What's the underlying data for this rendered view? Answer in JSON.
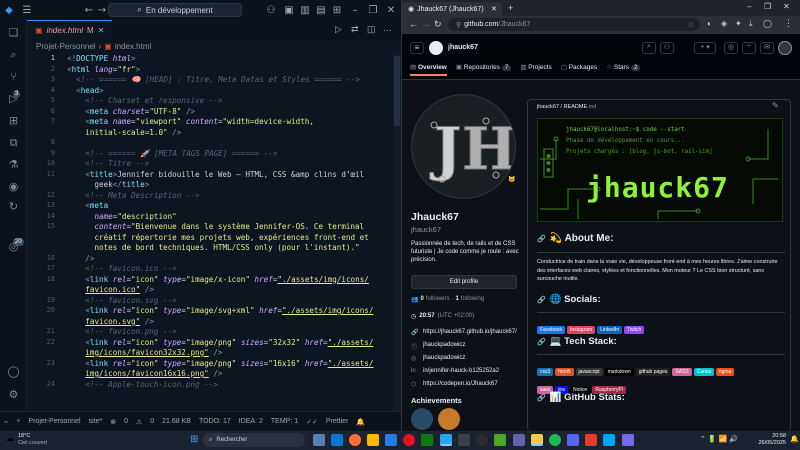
{
  "vscode": {
    "title": "En développement",
    "tab": {
      "name": "index.html",
      "status": "M"
    },
    "breadcrumb": [
      "Projet-Personnel",
      "index.html"
    ],
    "activity_badges": [
      "3",
      "20"
    ],
    "lines": [
      {
        "n": "1",
        "html": "<span class='p'>&lt;!</span><span class='t'>DOCTYPE</span> <span class='a'>html</span><span class='p'>&gt;</span>"
      },
      {
        "n": "2",
        "html": "<span class='p'>&lt;</span><span class='t'>html</span> <span class='a'>lang</span>=<span class='s'>\"fr\"</span><span class='p'>&gt;</span>"
      },
      {
        "n": "3",
        "html": "  <span class='c'>&lt;!-- ====== 🧠 [HEAD] : Titre, Meta Datas et Styles ====== --&gt;</span>"
      },
      {
        "n": "4",
        "html": "  <span class='p'>&lt;</span><span class='t'>head</span><span class='p'>&gt;</span>"
      },
      {
        "n": "5",
        "html": "    <span class='c'>&lt;!-- Charset et responsive --&gt;</span>"
      },
      {
        "n": "6",
        "html": "    <span class='p'>&lt;</span><span class='t'>meta</span> <span class='a'>charset</span>=<span class='s'>\"UTF-8\"</span> <span class='p'>/&gt;</span>"
      },
      {
        "n": "7",
        "html": "    <span class='p'>&lt;</span><span class='t'>meta</span> <span class='a'>name</span>=<span class='s'>\"viewport\"</span> <span class='a'>content</span>=<span class='s'>\"width=device-width,</span>"
      },
      {
        "n": "",
        "html": "    <span class='s'>initial-scale=1.0\"</span> <span class='p'>/&gt;</span>"
      },
      {
        "n": "8",
        "html": ""
      },
      {
        "n": "9",
        "html": "    <span class='c'>&lt;!-- ====== 🚀 [META TAGS PAGE] ====== --&gt;</span>"
      },
      {
        "n": "10",
        "html": "    <span class='c'>&lt;!-- Titre --&gt;</span>"
      },
      {
        "n": "11",
        "html": "    <span class='p'>&lt;</span><span class='t'>title</span><span class='p'>&gt;</span>Jennifer bidouille le Web – HTML, CSS &amp;amp clins d’œil"
      },
      {
        "n": "",
        "html": "      geek<span class='p'>&lt;/</span><span class='t'>title</span><span class='p'>&gt;</span>"
      },
      {
        "n": "12",
        "html": "    <span class='c'>&lt;!-- Meta Description --&gt;</span>"
      },
      {
        "n": "13",
        "html": "    <span class='p'>&lt;</span><span class='t'>meta</span>"
      },
      {
        "n": "14",
        "html": "      <span class='a'>name</span>=<span class='s'>\"description\"</span>"
      },
      {
        "n": "15",
        "html": "      <span class='a'>content</span>=<span class='s'>\"Bienvenue dans le système Jennifer-OS. Ce terminal</span>"
      },
      {
        "n": "",
        "html": "      <span class='s'>créatif répertorie mes projets web, expériences front-end et</span>"
      },
      {
        "n": "",
        "html": "      <span class='s'>notes de bord techniques. HTML/CSS only (pour l'instant).\"</span>"
      },
      {
        "n": "16",
        "html": "    <span class='p'>/&gt;</span>"
      },
      {
        "n": "17",
        "html": "    <span class='c'>&lt;!-- favicon.ico --&gt;</span>"
      },
      {
        "n": "18",
        "html": "    <span class='p'>&lt;</span><span class='t'>link</span> <span class='a'>rel</span>=<span class='s'>\"icon\"</span> <span class='a'>type</span>=<span class='s'>\"image/x-icon\"</span> <span class='a'>href</span>=<span class='s'><u>\"./assets/img/icons/</u></span>"
      },
      {
        "n": "",
        "html": "    <span class='s'><u>favicon.ico\"</u></span> <span class='p'>/&gt;</span>"
      },
      {
        "n": "19",
        "html": "    <span class='c'>&lt;!-- favicon.svg --&gt;</span>"
      },
      {
        "n": "20",
        "html": "    <span class='p'>&lt;</span><span class='t'>link</span> <span class='a'>rel</span>=<span class='s'>\"icon\"</span> <span class='a'>type</span>=<span class='s'>\"image/svg+xml\"</span> <span class='a'>href</span>=<span class='s'><u>\"./assets/img/icons/</u></span>"
      },
      {
        "n": "",
        "html": "    <span class='s'><u>favicon.svg\"</u></span> <span class='p'>/&gt;</span>"
      },
      {
        "n": "21",
        "html": "    <span class='c'>&lt;!-- favicon.png --&gt;</span>"
      },
      {
        "n": "22",
        "html": "    <span class='p'>&lt;</span><span class='t'>link</span> <span class='a'>rel</span>=<span class='s'>\"icon\"</span> <span class='a'>type</span>=<span class='s'>\"image/png\"</span> <span class='a'>sizes</span>=<span class='s'>\"32x32\"</span> <span class='a'>href</span>=<span class='s'><u>\"./assets/</u></span>"
      },
      {
        "n": "",
        "html": "    <span class='s'><u>img/icons/favicon32x32.png\"</u></span> <span class='p'>/&gt;</span>"
      },
      {
        "n": "23",
        "html": "    <span class='p'>&lt;</span><span class='t'>link</span> <span class='a'>rel</span>=<span class='s'>\"icon\"</span> <span class='a'>type</span>=<span class='s'>\"image/png\"</span> <span class='a'>sizes</span>=<span class='s'>\"16x16\"</span> <span class='a'>href</span>=<span class='s'><u>\"./assets/</u></span>"
      },
      {
        "n": "",
        "html": "    <span class='s'><u>img/icons/favicon16x16.png\"</u></span> <span class='p'>/&gt;</span>"
      },
      {
        "n": "24",
        "html": "    <span class='c'>&lt;!-- Apple-touch-icon.png --&gt;</span>"
      }
    ],
    "status": {
      "branch": "Projet-Personnel",
      "site": "site*",
      "errors": "0",
      "warnings": "0",
      "size": "21.68 KB",
      "todo": "TODO: 17",
      "idea": "IDEA: 2",
      "temp": "TEMP: 1",
      "prettier": "Prettier"
    }
  },
  "browser": {
    "tab_title": "Jhauck67 (Jhauck67)",
    "url_host": "github.com",
    "url_path": "/Jhauck67",
    "gh_user": "jhauck67",
    "nav": [
      {
        "label": "Overview",
        "count": ""
      },
      {
        "label": "Repositories",
        "count": "7"
      },
      {
        "label": "Projects",
        "count": ""
      },
      {
        "label": "Packages",
        "count": ""
      },
      {
        "label": "Stars",
        "count": "2"
      }
    ],
    "profile": {
      "name": "Jhauck67",
      "login": "jhauck67",
      "bio": "Passionnée de tech, de rails et de CSS futuriste | Je code comme je roule : avec précision.",
      "edit_button": "Edit profile",
      "followers": "0",
      "followers_label": "followers",
      "following": "1",
      "following_label": "following",
      "time": "20:57",
      "tz": "(UTC +02:00)",
      "links": [
        "https://jhauck67.github.io/jhauck67/",
        "jhauckpadowicz",
        "jhauckpadowicz",
        "in/jennifer-hauck-b125252a2",
        "https://codepen.io/Jhauck67"
      ],
      "achievements": "Achievements"
    },
    "readme": {
      "path": "jhauck67 / README",
      "ext": ".md",
      "terminal": [
        "jhauck67@localhost:~$ code --start",
        "Phase de développement en cours...",
        "Projets chargés : [blog, js-bot, rail-sim]"
      ],
      "banner": "jhauck67",
      "about_title": "💫 About Me:",
      "about_text": "Conductrice de train dans la vraie vie, développeuse front-end à mes heures libres. J'aime construire des interfaces web claires, stylées et fonctionnelles. Mon moteur ? Le CSS bien structuré, sans surcouche inutile.",
      "socials_title": "🌐 Socials:",
      "socials": [
        {
          "label": "Facebook",
          "color": "#1877f2"
        },
        {
          "label": "Instagram",
          "color": "#e4405f"
        },
        {
          "label": "LinkedIn",
          "color": "#0a66c2"
        },
        {
          "label": "Twitch",
          "color": "#9146ff"
        }
      ],
      "tech_title": "💻 Tech Stack:",
      "tech": [
        {
          "label": "css3",
          "color": "#1572b6"
        },
        {
          "label": "html5",
          "color": "#e34f26"
        },
        {
          "label": "javascript",
          "color": "#323330"
        },
        {
          "label": "markdown",
          "color": "#000000"
        },
        {
          "label": "github pages",
          "color": "#222222"
        },
        {
          "label": "SASS",
          "color": "#cd6799"
        },
        {
          "label": "Canva",
          "color": "#00c4cc"
        },
        {
          "label": "figma",
          "color": "#f24e1e"
        },
        {
          "label": "sass",
          "color": "#cd6799"
        },
        {
          "label": "jira",
          "color": "#0a0fff"
        },
        {
          "label": "Notion",
          "color": "#000000"
        },
        {
          "label": "RaspberryPi",
          "color": "#a22846"
        }
      ],
      "stats_title": "📊 GitHub Stats:"
    }
  },
  "taskbar": {
    "temp": "18°C",
    "weather": "Ciel couvert",
    "search": "Rechercher",
    "time": "20:58",
    "date": "26/05/2025"
  }
}
